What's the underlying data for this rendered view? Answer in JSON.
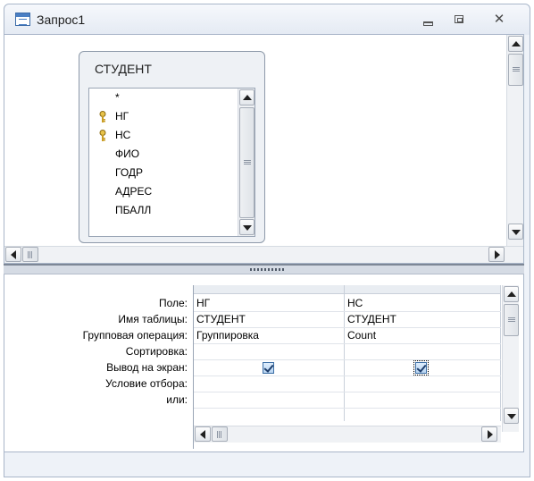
{
  "window": {
    "title": "Запрос1"
  },
  "titlebar_icons": [
    "query-icon",
    "minimize-icon",
    "maximize-icon",
    "close-icon"
  ],
  "close_glyph": "✕",
  "table": {
    "name": "СТУДЕНТ",
    "fields": [
      {
        "name": "*",
        "key": false
      },
      {
        "name": "НГ",
        "key": true
      },
      {
        "name": "НС",
        "key": true
      },
      {
        "name": "ФИО",
        "key": false
      },
      {
        "name": "ГОДР",
        "key": false
      },
      {
        "name": "АДРЕС",
        "key": false
      },
      {
        "name": "ПБАЛЛ",
        "key": false
      }
    ]
  },
  "grid": {
    "row_labels": [
      "Поле:",
      "Имя таблицы:",
      "Групповая операция:",
      "Сортировка:",
      "Вывод на экран:",
      "Условие отбора:",
      "или:"
    ],
    "columns": [
      {
        "field": "НГ",
        "table": "СТУДЕНТ",
        "total": "Группировка",
        "sort": "",
        "show": true,
        "criteria": "",
        "or": ""
      },
      {
        "field": "НС",
        "table": "СТУДЕНТ",
        "total": "Count",
        "sort": "",
        "show": true,
        "criteria": "",
        "or": ""
      }
    ]
  },
  "colors": {
    "accent": "#3b6ea5",
    "window_bg": "#eef2f8",
    "splitter": "#7d8796"
  }
}
